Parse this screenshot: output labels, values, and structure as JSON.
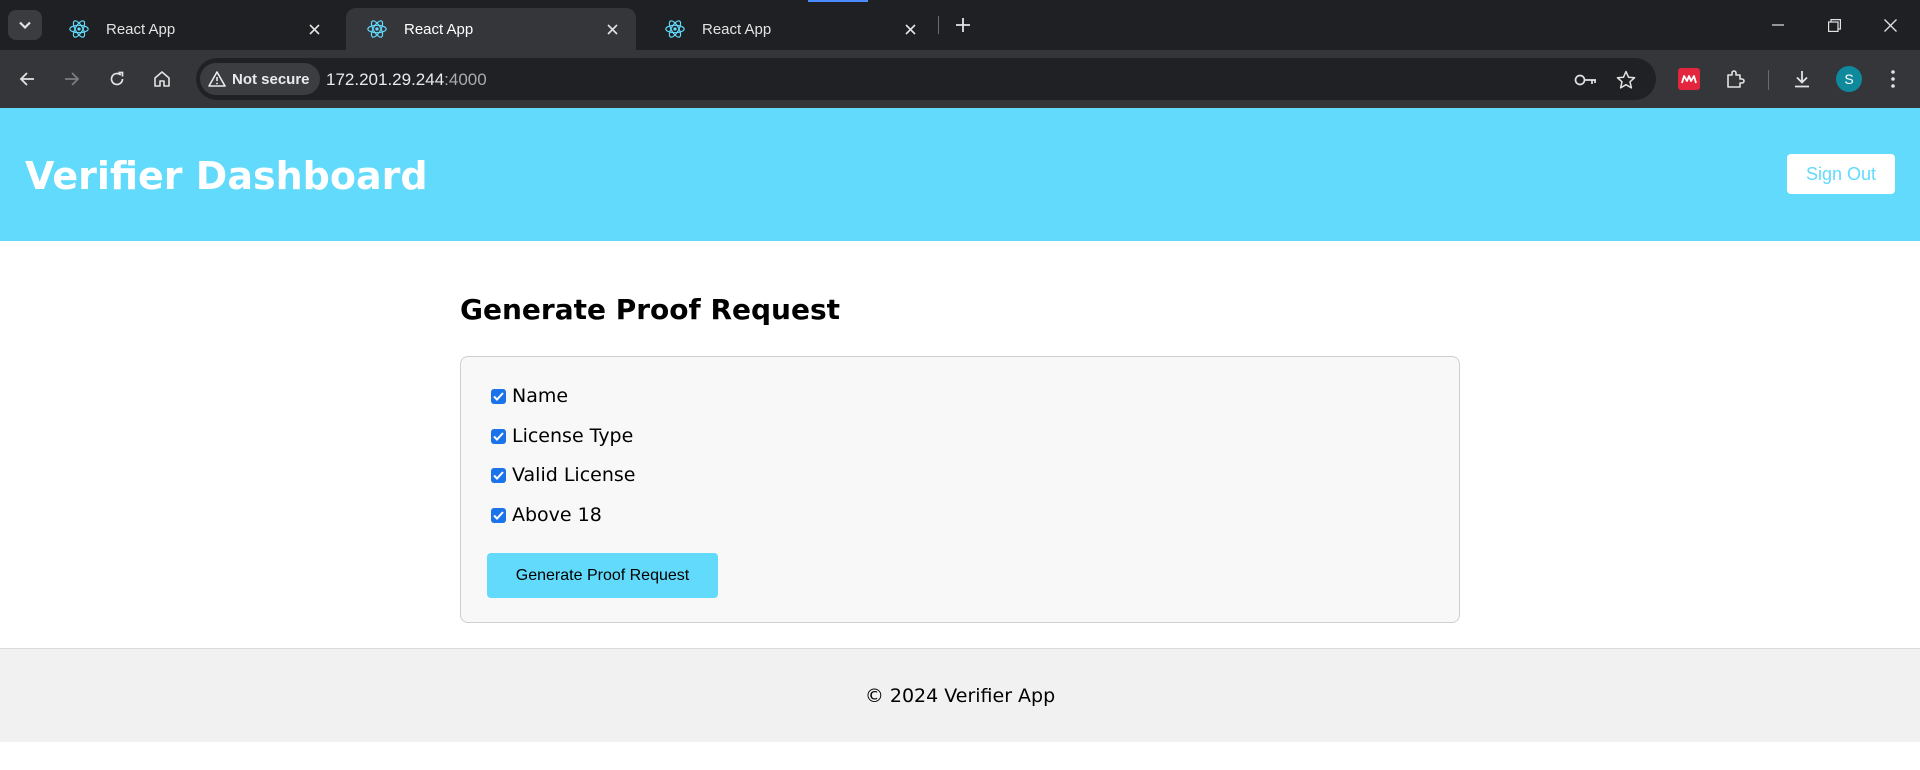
{
  "browser": {
    "tabs": [
      {
        "title": "React App",
        "active": false
      },
      {
        "title": "React App",
        "active": true
      },
      {
        "title": "React App",
        "active": false
      }
    ],
    "security_chip": "Not secure",
    "url_host": "172.201.29.244",
    "url_port": ":4000",
    "profile_initial": "S",
    "icons": {
      "tab_search": "chevron-down-icon",
      "tab_favicon": "react-icon",
      "new_tab": "plus-icon",
      "back": "arrow-left-icon",
      "forward": "arrow-right-icon",
      "reload": "reload-icon",
      "home": "home-icon",
      "security": "warning-triangle-icon",
      "password": "key-icon",
      "bookmark": "star-icon",
      "extension_mendeley": "mendeley-icon",
      "extensions": "puzzle-icon",
      "downloads": "download-icon",
      "menu": "kebab-menu-icon"
    }
  },
  "header": {
    "title": "Verifier Dashboard",
    "sign_out": "Sign Out"
  },
  "main": {
    "section_title": "Generate Proof Request",
    "options": [
      {
        "label": "Name",
        "checked": true
      },
      {
        "label": "License Type",
        "checked": true
      },
      {
        "label": "Valid License",
        "checked": true
      },
      {
        "label": "Above 18",
        "checked": true
      }
    ],
    "generate_button": "Generate Proof Request"
  },
  "footer": {
    "text": "© 2024 Verifier App"
  },
  "colors": {
    "accent": "#61dafb",
    "chrome_dark": "#1f2023",
    "chrome_toolbar": "#35363a",
    "checkbox": "#1a73e8"
  }
}
